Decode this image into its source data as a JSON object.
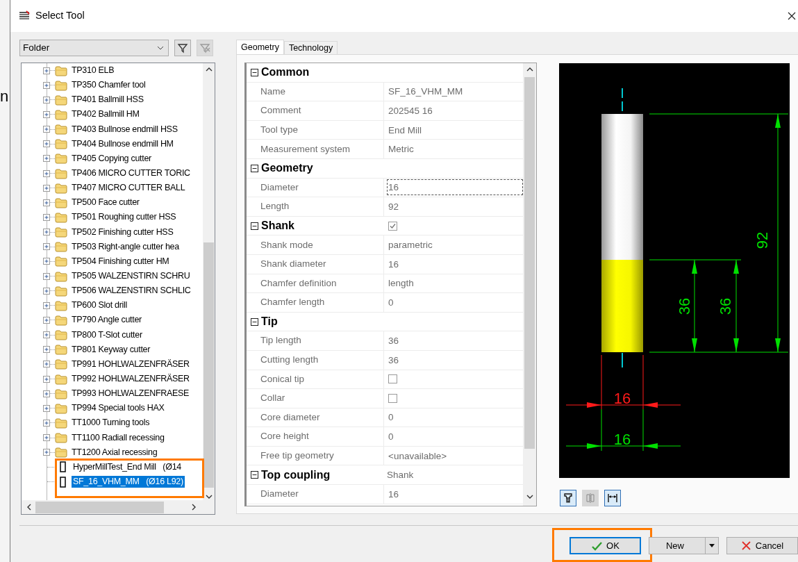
{
  "window": {
    "title": "Select Tool"
  },
  "background_fragment": "n",
  "filter": {
    "value": "Folder"
  },
  "filter_buttons": [
    {
      "kind": "filter",
      "disabled": false
    },
    {
      "kind": "clear_filter",
      "disabled": true
    }
  ],
  "tree": {
    "folders": [
      {
        "label": "TP310 ELB",
        "selected": false
      },
      {
        "label": "TP350 Chamfer tool",
        "selected": false
      },
      {
        "label": "TP401 Ballmill HSS",
        "selected": false
      },
      {
        "label": "TP402 Ballmill HM",
        "selected": false
      },
      {
        "label": "TP403 Bullnose endmill HSS",
        "selected": false
      },
      {
        "label": "TP404 Bullnose endmill HM",
        "selected": false
      },
      {
        "label": "TP405 Copying cutter",
        "selected": false
      },
      {
        "label": "TP406 MICRO CUTTER TORIC",
        "selected": false
      },
      {
        "label": "TP407 MICRO CUTTER BALL",
        "selected": false
      },
      {
        "label": "TP500 Face cutter",
        "selected": false
      },
      {
        "label": "TP501 Roughing cutter HSS",
        "selected": false
      },
      {
        "label": "TP502 Finishing cutter HSS",
        "selected": false
      },
      {
        "label": "TP503 Right-angle cutter hea",
        "selected": false
      },
      {
        "label": "TP504 Finishing cutter HM",
        "selected": false
      },
      {
        "label": "TP505 WALZENSTIRN SCHRU",
        "selected": false
      },
      {
        "label": "TP506 WALZENSTIRN SCHLIC",
        "selected": false
      },
      {
        "label": "TP600 Slot drill",
        "selected": false
      },
      {
        "label": "TP790 Angle cutter",
        "selected": false
      },
      {
        "label": "TP800 T-Slot cutter",
        "selected": false
      },
      {
        "label": "TP801 Keyway cutter",
        "selected": false
      },
      {
        "label": "TP991 HOHLWALZENFRÄSER",
        "selected": false
      },
      {
        "label": "TP992 HOHLWALZENFRÄSER",
        "selected": false
      },
      {
        "label": "TP993 HOHLWALZENFRAESE",
        "selected": false
      },
      {
        "label": "TP994 Special tools HAX",
        "selected": false
      },
      {
        "label": "TT1000 Turning tools",
        "selected": false
      },
      {
        "label": "TT1100 Radiall recessing",
        "selected": false
      },
      {
        "label": "TT1200 Axial recessing",
        "selected": false
      }
    ],
    "tools": {
      "highlighted": true,
      "items": [
        {
          "label": "HyperMillTest_End Mill   (Ø14",
          "selected": false
        },
        {
          "label": "SF_16_VHM_MM   (Ø16 L92)",
          "selected": true
        }
      ]
    }
  },
  "tabs": [
    {
      "label": "Geometry",
      "selected": true
    },
    {
      "label": "Technology",
      "selected": false
    }
  ],
  "properties": [
    {
      "group": "Common",
      "expanded": true,
      "kind": "plain",
      "rows": [
        {
          "label": "Name",
          "kind": "text",
          "value": "SF_16_VHM_MM",
          "selected": false
        },
        {
          "label": "Comment",
          "kind": "text",
          "value": "202545 16",
          "selected": false
        },
        {
          "label": "Tool type",
          "kind": "text",
          "value": "End Mill",
          "selected": false
        },
        {
          "label": "Measurement system",
          "kind": "text",
          "value": "Metric",
          "selected": false
        }
      ]
    },
    {
      "group": "Geometry",
      "expanded": true,
      "kind": "plain",
      "rows": [
        {
          "label": "Diameter",
          "kind": "text",
          "value": "16",
          "selected": true
        },
        {
          "label": "Length",
          "kind": "text",
          "value": "92",
          "selected": false
        }
      ]
    },
    {
      "group": "Shank",
      "expanded": true,
      "kind": "checkbox",
      "checked": true,
      "rows": [
        {
          "label": "Shank mode",
          "kind": "text",
          "value": "parametric",
          "selected": false
        },
        {
          "label": "Shank diameter",
          "kind": "text",
          "value": "16",
          "selected": false
        },
        {
          "label": "Chamfer definition",
          "kind": "text",
          "value": "length",
          "selected": false
        },
        {
          "label": "Chamfer length",
          "kind": "text",
          "value": "0",
          "selected": false
        }
      ]
    },
    {
      "group": "Tip",
      "expanded": true,
      "kind": "plain",
      "rows": [
        {
          "label": "Tip length",
          "kind": "text",
          "value": "36",
          "selected": false
        },
        {
          "label": "Cutting length",
          "kind": "text",
          "value": "36",
          "selected": false
        },
        {
          "label": "Conical tip",
          "kind": "checkbox",
          "checked": false,
          "selected": false
        },
        {
          "label": "Collar",
          "kind": "checkbox",
          "checked": false,
          "selected": false
        },
        {
          "label": "Core diameter",
          "kind": "text",
          "value": "0",
          "selected": false
        },
        {
          "label": "Core height",
          "kind": "text",
          "value": "0",
          "selected": false
        },
        {
          "label": "Free tip geometry",
          "kind": "text",
          "value": "<unavailable>",
          "selected": false
        }
      ]
    },
    {
      "group": "Top coupling",
      "expanded": true,
      "kind": "text",
      "value": "Shank",
      "rows": [
        {
          "label": "Diameter",
          "kind": "text",
          "value": "16",
          "selected": false
        }
      ]
    }
  ],
  "preview": {
    "labels": [
      {
        "kind": "overall_length",
        "text": "92",
        "color": "#00e000"
      },
      {
        "kind": "tip_length",
        "text": "36",
        "color": "#00e000"
      },
      {
        "kind": "cutting_length",
        "text": "36",
        "color": "#00e000"
      },
      {
        "kind": "cutting_diameter",
        "text": "16",
        "color": "#ff1a1a"
      },
      {
        "kind": "shank_diameter",
        "text": "16",
        "color": "#00e000"
      }
    ]
  },
  "preview_buttons": [
    {
      "kind": "holder",
      "on": true,
      "disabled": false
    },
    {
      "kind": "mirror",
      "on": false,
      "disabled": true
    },
    {
      "kind": "dimensions",
      "on": true,
      "disabled": false
    }
  ],
  "buttons": [
    {
      "kind": "ok",
      "label": "OK",
      "default": true,
      "highlighted": true
    },
    {
      "kind": "new",
      "label": "New",
      "default": false,
      "highlighted": false
    },
    {
      "kind": "cancel",
      "label": "Cancel",
      "default": false,
      "highlighted": false
    }
  ]
}
